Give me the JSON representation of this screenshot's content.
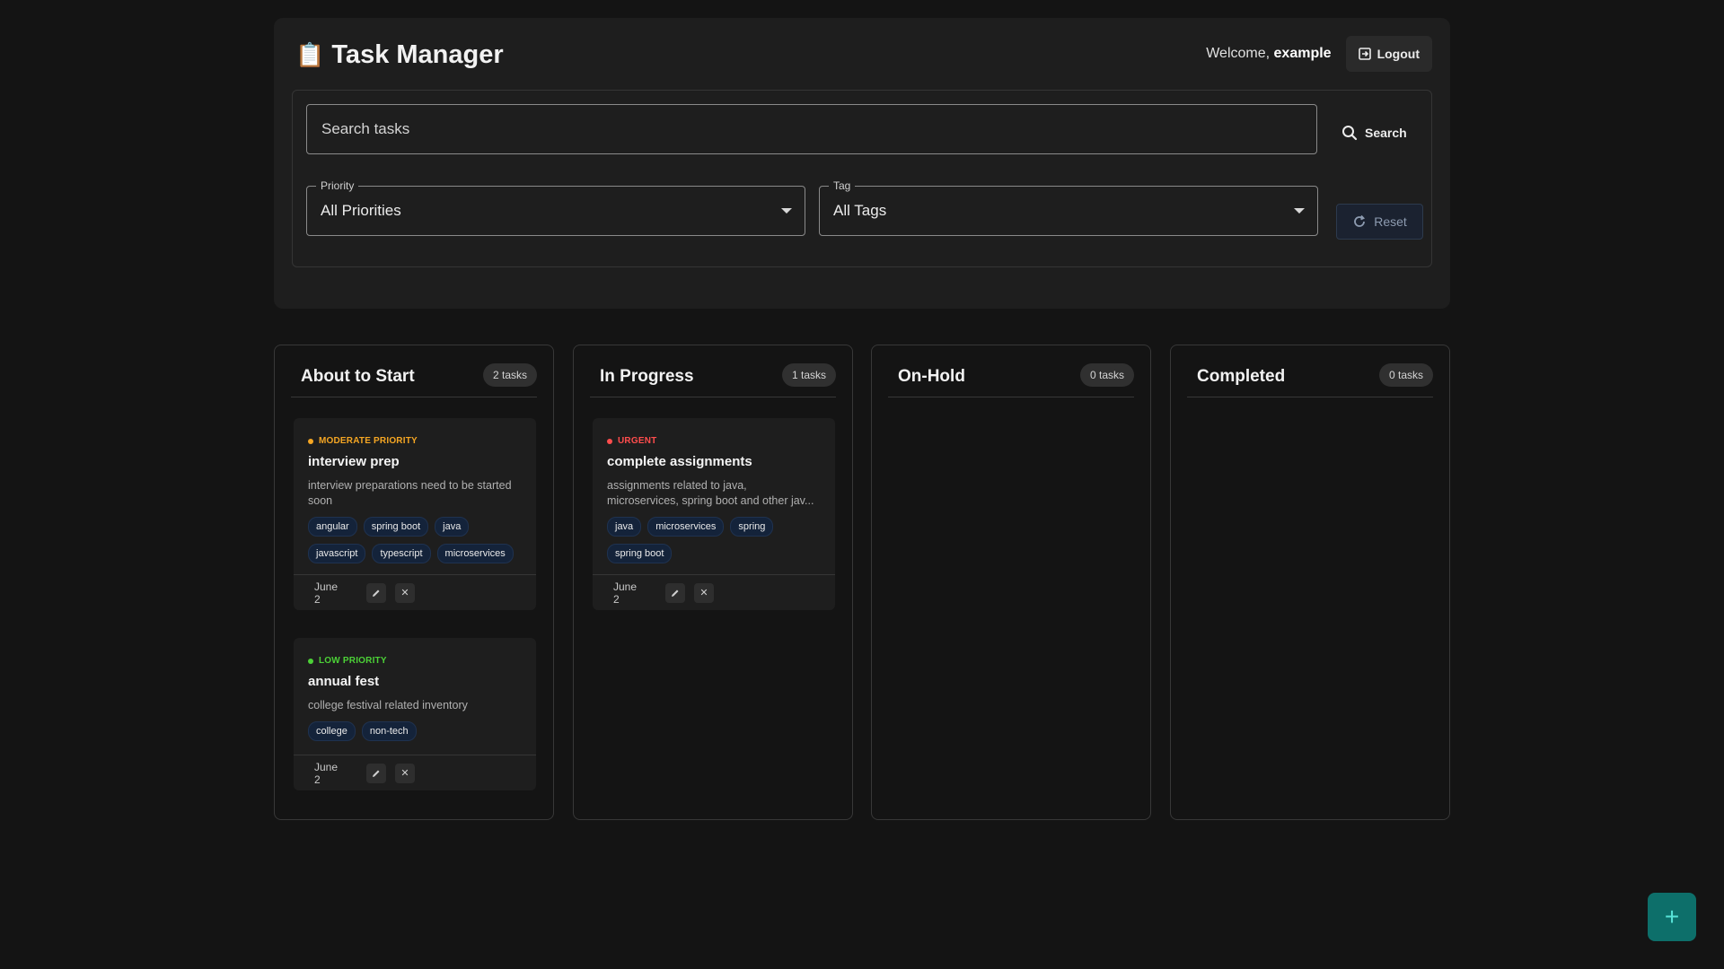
{
  "app": {
    "icon": "clipboard-icon",
    "title": "Task Manager",
    "welcome_prefix": "Welcome,",
    "username": "example",
    "logout_label": "Logout"
  },
  "filters": {
    "search_placeholder": "Search tasks",
    "search_value": "",
    "search_label": "Search",
    "priority_label": "Priority",
    "priority_value": "All Priorities",
    "tag_label": "Tag",
    "tag_value": "All Tags",
    "reset_label": "Reset"
  },
  "columns": [
    {
      "title": "About to Start",
      "count": "2 tasks",
      "cards": [
        {
          "priority": "MODERATE PRIORITY",
          "priority_color": "#f5a623",
          "title": "interview prep",
          "description": "interview preparations need to be started soon",
          "tags": [
            "angular",
            "spring boot",
            "java",
            "javascript",
            "typescript",
            "microservices"
          ],
          "date": "June 2"
        },
        {
          "priority": "LOW PRIORITY",
          "priority_color": "#4cd137",
          "title": "annual fest",
          "description": "college festival related inventory",
          "tags": [
            "college",
            "non-tech"
          ],
          "date": "June 2"
        }
      ]
    },
    {
      "title": "In Progress",
      "count": "1 tasks",
      "cards": [
        {
          "priority": "URGENT",
          "priority_color": "#ff4d4d",
          "title": "complete assignments",
          "description": "assignments related to java, microservices, spring boot and other jav...",
          "tags": [
            "java",
            "microservices",
            "spring",
            "spring boot"
          ],
          "date": "June 2"
        }
      ]
    },
    {
      "title": "On-Hold",
      "count": "0 tasks",
      "cards": []
    },
    {
      "title": "Completed",
      "count": "0 tasks",
      "cards": []
    }
  ],
  "fab": {
    "label": "+",
    "icon": "plus-icon"
  }
}
